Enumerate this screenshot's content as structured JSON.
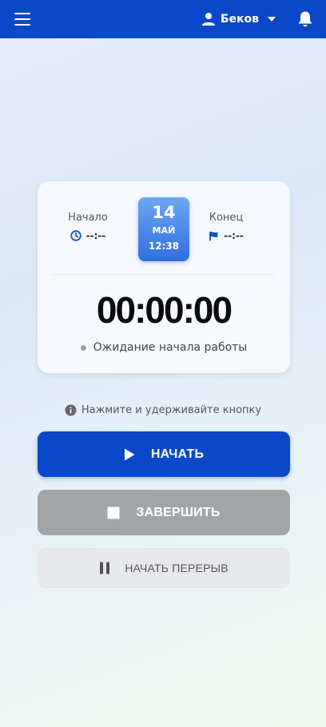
{
  "topbar": {
    "user_name": "Беков",
    "colors": {
      "bar": "#0a48c9"
    }
  },
  "card": {
    "start_label": "Начало",
    "start_value": "--:--",
    "end_label": "Конец",
    "end_value": "--:--",
    "date": {
      "day": "14",
      "month": "МАЙ",
      "time": "12:38"
    },
    "timer": "00:00:00",
    "status": "Ожидание начала работы"
  },
  "hint": "Нажмите и удерживайте кнопку",
  "buttons": {
    "start": "НАЧАТЬ",
    "finish": "ЗАВЕРШИТЬ",
    "break": "НАЧАТЬ ПЕРЕРЫВ"
  },
  "icons": [
    "menu-icon",
    "user-icon",
    "caret-down-icon",
    "bell-icon",
    "clock-icon",
    "flag-icon",
    "info-icon",
    "play-icon",
    "stop-icon",
    "pause-icon"
  ]
}
